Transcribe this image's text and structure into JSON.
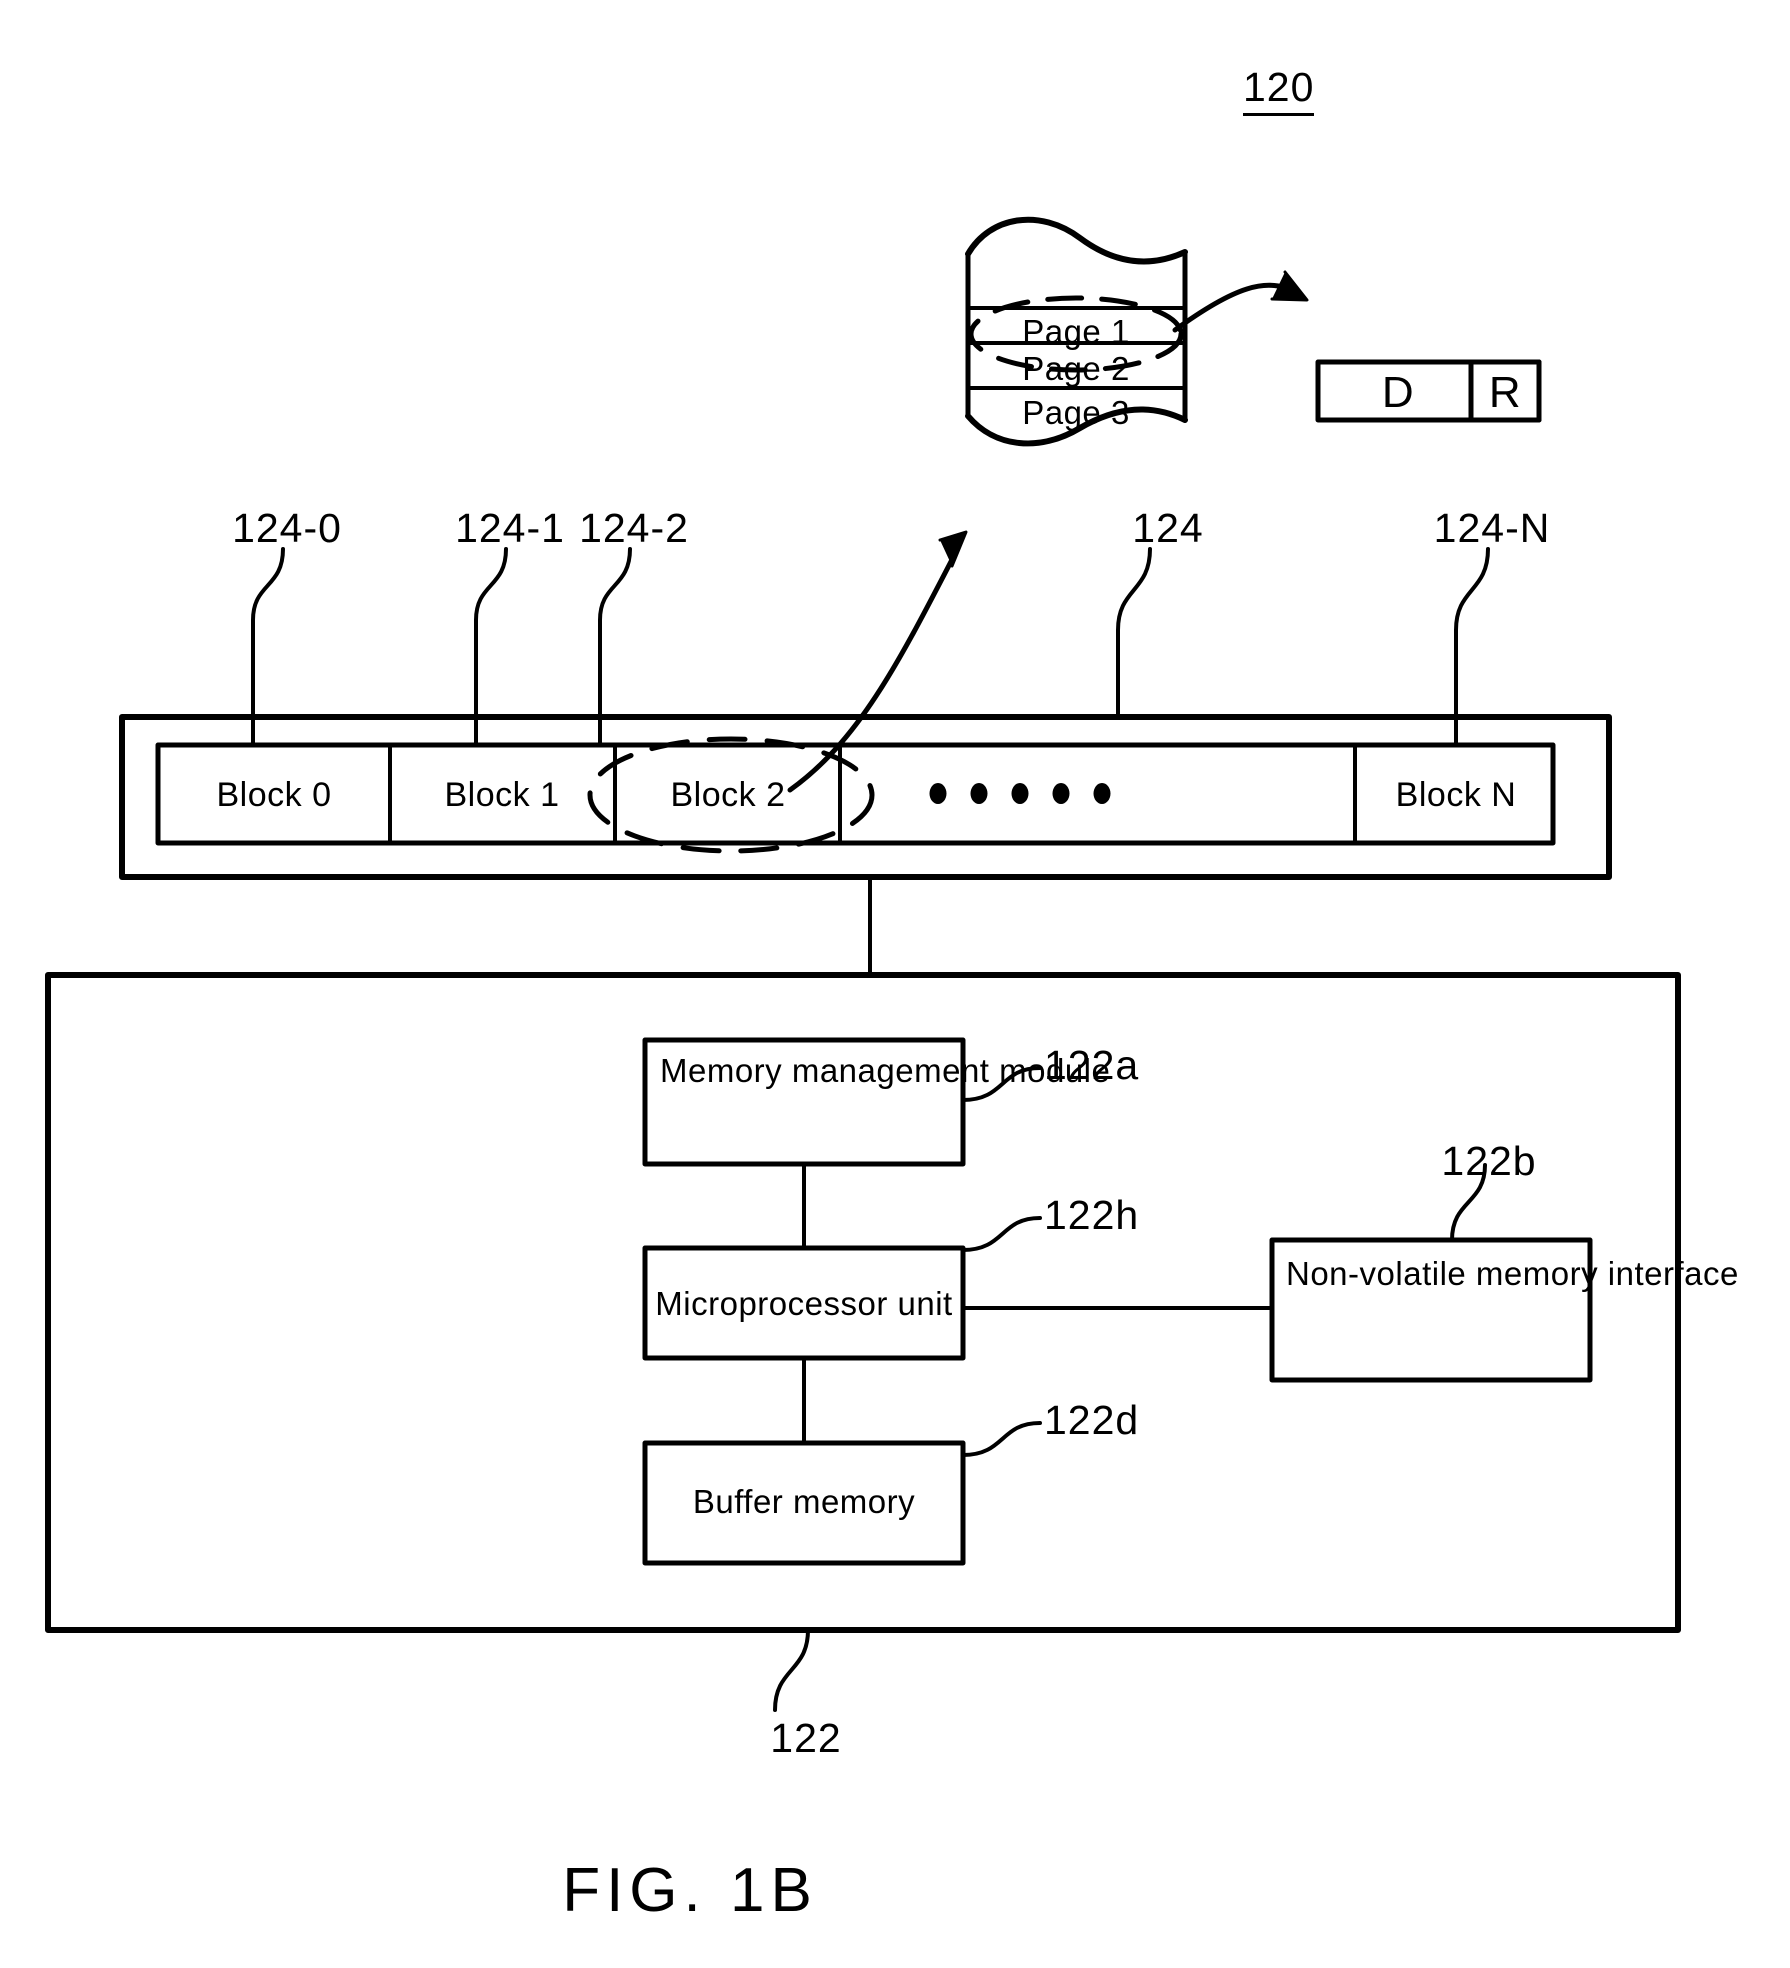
{
  "figure": {
    "caption": "FIG. 1B",
    "top_reference": "120"
  },
  "page_stack": {
    "reference": "",
    "pages": [
      {
        "label": "Page 1",
        "highlighted": true
      },
      {
        "label": "Page 2",
        "highlighted": false
      },
      {
        "label": "Page 3",
        "highlighted": false
      }
    ]
  },
  "page_detail": {
    "cells": [
      {
        "label": "D",
        "name": "data-area-cell"
      },
      {
        "label": "R",
        "name": "redundancy-area-cell"
      }
    ]
  },
  "block_row": {
    "reference": "124",
    "blocks": [
      {
        "label": "Block 0",
        "reference": "124-0",
        "highlighted": false
      },
      {
        "label": "Block 1",
        "reference": "124-1",
        "highlighted": false
      },
      {
        "label": "Block 2",
        "reference": "124-2",
        "highlighted": true
      },
      {
        "label": "",
        "reference": "",
        "ellipsis": true,
        "dots": 5
      },
      {
        "label": "Block N",
        "reference": "124-N",
        "highlighted": false
      }
    ]
  },
  "controller": {
    "reference": "122",
    "modules": [
      {
        "label": "Memory management module",
        "reference": "122a",
        "align": "left"
      },
      {
        "label": "Microprocessor unit",
        "reference": "122h",
        "align": "center"
      },
      {
        "label": "Buffer memory",
        "reference": "122d",
        "align": "center"
      },
      {
        "label": "Non-volatile memory interface",
        "reference": "122b",
        "align": "left"
      }
    ]
  },
  "colors": {
    "line": "#000000",
    "background": "#ffffff"
  }
}
